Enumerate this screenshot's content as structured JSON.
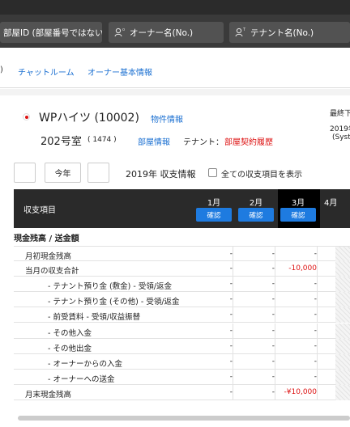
{
  "search": {
    "room_id_placeholder": "部屋ID (部屋番号ではない",
    "owner_placeholder": "オーナー名(No.)",
    "tenant_placeholder": "テナント名(No.)"
  },
  "tabs": [
    ")",
    "チャットルーム",
    "オーナー基本情報"
  ],
  "property": {
    "name": "WPハイツ (10002)",
    "info_link": "物件情報",
    "room": "202号室",
    "room_no": "( 1474 )",
    "room_info_link": "部屋情報",
    "tenant_label": "テナント：",
    "contract_link": "部屋契約履歴"
  },
  "side_info": {
    "line1": "最終下",
    "line2": "2019年",
    "line3": "(Syst"
  },
  "controls": {
    "this_year": "今年",
    "year_title": "2019年 収支情報",
    "show_all_label": "全ての収支項目を表示"
  },
  "table": {
    "item_header": "収支項目",
    "months": [
      "1月",
      "2月",
      "3月",
      "4月"
    ],
    "confirm_label": "確認",
    "section_title": "現金残高 / 送金額",
    "rows": [
      {
        "label": "月初現金残高",
        "indent": 1,
        "values": [
          "-",
          "-",
          "-"
        ]
      },
      {
        "label": "当月の収支合計",
        "indent": 1,
        "values": [
          "-",
          "-",
          "-10,000"
        ]
      },
      {
        "label": "- テナント預り金 (敷金) - 受領/返金",
        "indent": 2,
        "values": [
          "-",
          "-",
          "-"
        ]
      },
      {
        "label": "- テナント預り金 (その他) - 受領/返金",
        "indent": 2,
        "values": [
          "-",
          "-",
          "-"
        ]
      },
      {
        "label": "- 前受賃料 - 受領/収益振替",
        "indent": 2,
        "values": [
          "-",
          "-",
          "-"
        ]
      },
      {
        "label": "- その他入金",
        "indent": 2,
        "values": [
          "-",
          "-",
          "-"
        ]
      },
      {
        "label": "- その他出金",
        "indent": 2,
        "values": [
          "-",
          "-",
          "-"
        ]
      },
      {
        "label": "- オーナーからの入金",
        "indent": 2,
        "values": [
          "-",
          "-",
          "-"
        ]
      },
      {
        "label": "- オーナーへの送金",
        "indent": 2,
        "values": [
          "-",
          "-",
          "-"
        ]
      },
      {
        "label": "月末現金残高",
        "indent": 1,
        "values": [
          "-",
          "-",
          "-¥10,000"
        ]
      }
    ]
  }
}
